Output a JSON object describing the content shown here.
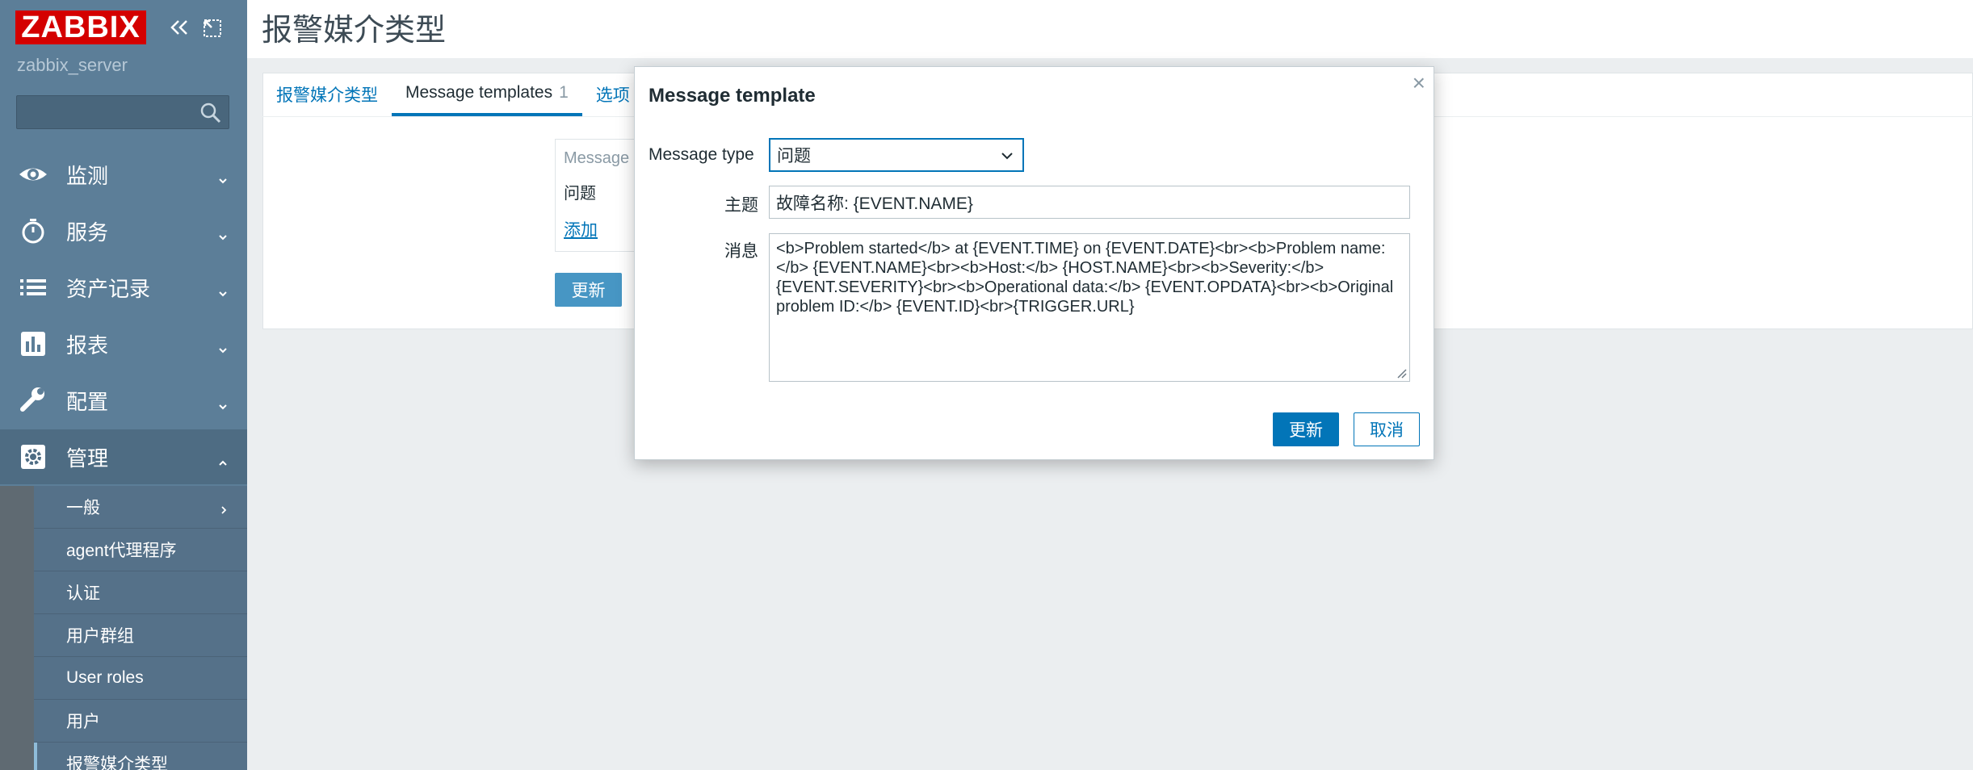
{
  "brand": {
    "logo": "ZABBIX",
    "server_name": "zabbix_server"
  },
  "sidebar": {
    "search": {
      "value": "",
      "placeholder": ""
    },
    "items": [
      {
        "label": "监测",
        "icon": "eye-icon"
      },
      {
        "label": "服务",
        "icon": "clock-icon"
      },
      {
        "label": "资产记录",
        "icon": "list-icon"
      },
      {
        "label": "报表",
        "icon": "bar-chart-icon"
      },
      {
        "label": "配置",
        "icon": "wrench-icon"
      },
      {
        "label": "管理",
        "icon": "gear-icon"
      }
    ],
    "admin_sub": [
      {
        "label": "一般"
      },
      {
        "label": "agent代理程序"
      },
      {
        "label": "认证"
      },
      {
        "label": "用户群组"
      },
      {
        "label": "User roles"
      },
      {
        "label": "用户"
      },
      {
        "label": "报警媒介类型"
      }
    ]
  },
  "page": {
    "title": "报警媒介类型",
    "tabs": [
      {
        "label": "报警媒介类型"
      },
      {
        "label": "Message templates",
        "count": "1"
      },
      {
        "label": "选项"
      }
    ],
    "templates_box": {
      "header": "Message",
      "row": "问题",
      "add_label": "添加"
    },
    "update_label": "更新"
  },
  "modal": {
    "title": "Message template",
    "close": "×",
    "message_type_label": "Message type",
    "message_type_value": "问题",
    "subject_label": "主题",
    "subject_value": "故障名称: {EVENT.NAME}",
    "message_label": "消息",
    "message_value": "<b>Problem started</b> at {EVENT.TIME} on {EVENT.DATE}<br><b>Problem name:</b> {EVENT.NAME}<br><b>Host:</b> {HOST.NAME}<br><b>Severity:</b> {EVENT.SEVERITY}<br><b>Operational data:</b> {EVENT.OPDATA}<br><b>Original problem ID:</b> {EVENT.ID}<br>{TRIGGER.URL}",
    "update_button": "更新",
    "cancel_button": "取消"
  },
  "colors": {
    "sidebar": "#5c7e98",
    "accent": "#0275b8",
    "logo": "#d40000"
  }
}
